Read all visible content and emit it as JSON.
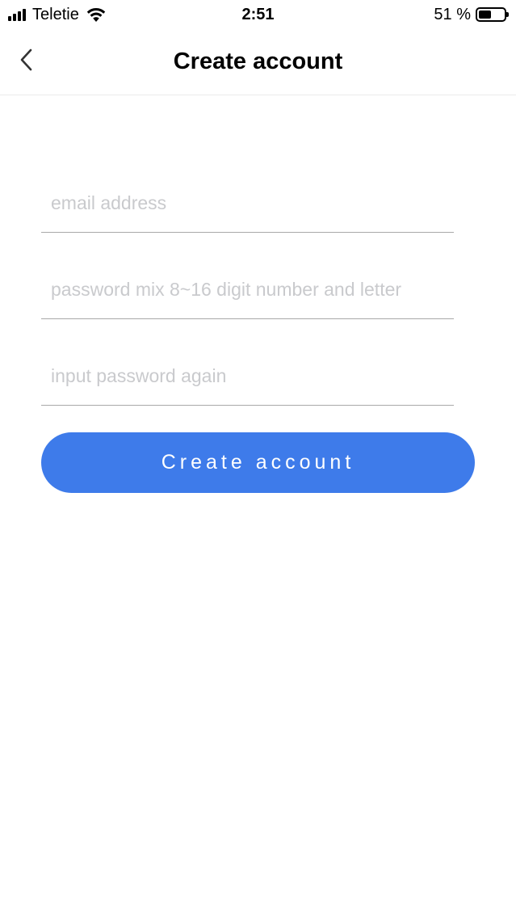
{
  "status_bar": {
    "carrier": "Teletie",
    "time": "2:51",
    "battery_percent_label": "51 %",
    "battery_level": 0.51,
    "signal_bars": 4,
    "icons": [
      "signal-icon",
      "wifi-icon",
      "battery-icon"
    ]
  },
  "nav": {
    "back_icon": "chevron-left-icon",
    "title": "Create account"
  },
  "form": {
    "email_placeholder": "email address",
    "email_value": "",
    "password_placeholder": "password mix 8~16 digit number and letter",
    "password_value": "",
    "confirm_placeholder": "input password again",
    "confirm_value": ""
  },
  "submit": {
    "label": "Create account"
  },
  "colors": {
    "accent": "#3e7bea",
    "placeholder": "#c9cacd",
    "underline": "#a9a9a9"
  }
}
